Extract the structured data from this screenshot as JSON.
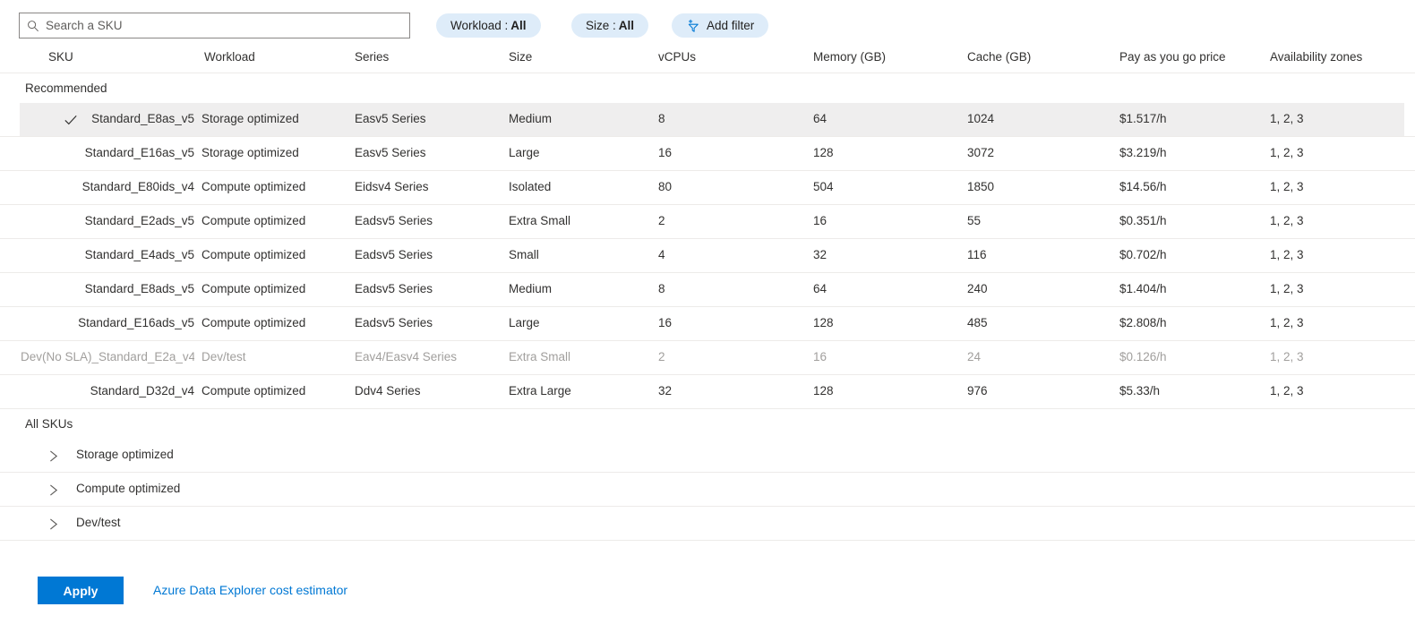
{
  "search": {
    "placeholder": "Search a SKU",
    "value": "",
    "icon": "search-icon"
  },
  "filters": {
    "workload": {
      "label": "Workload :",
      "value": "All"
    },
    "size": {
      "label": "Size :",
      "value": "All"
    },
    "add_filter": {
      "label": "Add filter",
      "icon": "add-filter-icon"
    }
  },
  "table": {
    "columns": [
      "SKU",
      "Workload",
      "Series",
      "Size",
      "vCPUs",
      "Memory (GB)",
      "Cache (GB)",
      "Pay as you go price",
      "Availability zones"
    ],
    "groups": [
      {
        "title": "Recommended",
        "rows": [
          {
            "sku": "Standard_E8as_v5",
            "workload": "Storage optimized",
            "series": "Easv5 Series",
            "size": "Medium",
            "vcpus": "8",
            "memory": "64",
            "cache": "1024",
            "price": "$1.517/h",
            "zones": "1, 2, 3",
            "selected": true,
            "disabled": false
          },
          {
            "sku": "Standard_E16as_v5",
            "workload": "Storage optimized",
            "series": "Easv5 Series",
            "size": "Large",
            "vcpus": "16",
            "memory": "128",
            "cache": "3072",
            "price": "$3.219/h",
            "zones": "1, 2, 3",
            "selected": false,
            "disabled": false
          },
          {
            "sku": "Standard_E80ids_v4",
            "workload": "Compute optimized",
            "series": "Eidsv4 Series",
            "size": "Isolated",
            "vcpus": "80",
            "memory": "504",
            "cache": "1850",
            "price": "$14.56/h",
            "zones": "1, 2, 3",
            "selected": false,
            "disabled": false
          },
          {
            "sku": "Standard_E2ads_v5",
            "workload": "Compute optimized",
            "series": "Eadsv5 Series",
            "size": "Extra Small",
            "vcpus": "2",
            "memory": "16",
            "cache": "55",
            "price": "$0.351/h",
            "zones": "1, 2, 3",
            "selected": false,
            "disabled": false
          },
          {
            "sku": "Standard_E4ads_v5",
            "workload": "Compute optimized",
            "series": "Eadsv5 Series",
            "size": "Small",
            "vcpus": "4",
            "memory": "32",
            "cache": "116",
            "price": "$0.702/h",
            "zones": "1, 2, 3",
            "selected": false,
            "disabled": false
          },
          {
            "sku": "Standard_E8ads_v5",
            "workload": "Compute optimized",
            "series": "Eadsv5 Series",
            "size": "Medium",
            "vcpus": "8",
            "memory": "64",
            "cache": "240",
            "price": "$1.404/h",
            "zones": "1, 2, 3",
            "selected": false,
            "disabled": false
          },
          {
            "sku": "Standard_E16ads_v5",
            "workload": "Compute optimized",
            "series": "Eadsv5 Series",
            "size": "Large",
            "vcpus": "16",
            "memory": "128",
            "cache": "485",
            "price": "$2.808/h",
            "zones": "1, 2, 3",
            "selected": false,
            "disabled": false
          },
          {
            "sku": "Dev(No SLA)_Standard_E2a_v4",
            "workload": "Dev/test",
            "series": "Eav4/Easv4 Series",
            "size": "Extra Small",
            "vcpus": "2",
            "memory": "16",
            "cache": "24",
            "price": "$0.126/h",
            "zones": "1, 2, 3",
            "selected": false,
            "disabled": true
          },
          {
            "sku": "Standard_D32d_v4",
            "workload": "Compute optimized",
            "series": "Ddv4 Series",
            "size": "Extra Large",
            "vcpus": "32",
            "memory": "128",
            "cache": "976",
            "price": "$5.33/h",
            "zones": "1, 2, 3",
            "selected": false,
            "disabled": false
          }
        ]
      }
    ],
    "all_skus": {
      "title": "All SKUs",
      "groups": [
        {
          "label": "Storage optimized",
          "expanded": false,
          "icon": "chevron-right-icon"
        },
        {
          "label": "Compute optimized",
          "expanded": false,
          "icon": "chevron-right-icon"
        },
        {
          "label": "Dev/test",
          "expanded": false,
          "icon": "chevron-right-icon"
        }
      ]
    }
  },
  "footer": {
    "apply_label": "Apply",
    "cost_estimator_label": "Azure Data Explorer cost estimator"
  },
  "colors": {
    "accent": "#0078d4",
    "pill_bg": "#deecf9",
    "selected_row_bg": "#efeeee",
    "divider": "#edebe9",
    "disabled_text": "#a19f9d",
    "text": "#323130"
  }
}
